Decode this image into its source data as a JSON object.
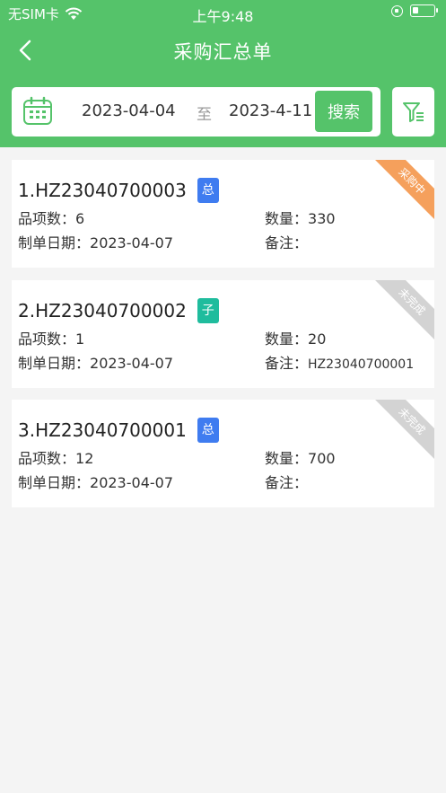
{
  "status_bar": {
    "carrier": "无SIM卡",
    "time": "上午9:48"
  },
  "nav": {
    "title": "采购汇总单"
  },
  "search": {
    "date_start": "2023-04-04",
    "separator": "至",
    "date_end": "2023-4-11",
    "button_label": "搜索"
  },
  "labels": {
    "item_count": "品项数：",
    "quantity": "数量：",
    "create_date": "制单日期：",
    "remark": "备注："
  },
  "orders": [
    {
      "no": "1.HZ23040700003",
      "tag": "总",
      "tag_color": "#3f7cf0",
      "item_count": "6",
      "quantity": "330",
      "date": "2023-04-07",
      "remark": "",
      "status": "采购中",
      "status_color": "#f5a05c"
    },
    {
      "no": "2.HZ23040700002",
      "tag": "子",
      "tag_color": "#1fbc9d",
      "item_count": "1",
      "quantity": "20",
      "date": "2023-04-07",
      "remark": "HZ23040700001",
      "status": "未完成",
      "status_color": "#d3d3d3"
    },
    {
      "no": "3.HZ23040700001",
      "tag": "总",
      "tag_color": "#3f7cf0",
      "item_count": "12",
      "quantity": "700",
      "date": "2023-04-07",
      "remark": "",
      "status": "未完成",
      "status_color": "#d3d3d3"
    }
  ],
  "colors": {
    "primary": "#55c36a",
    "background": "#f4f4f4"
  },
  "icons": {
    "back": "chevron-left-icon",
    "calendar": "calendar-icon",
    "filter": "filter-icon",
    "wifi": "wifi-icon",
    "battery": "battery-icon",
    "lock": "orientation-lock-icon"
  }
}
